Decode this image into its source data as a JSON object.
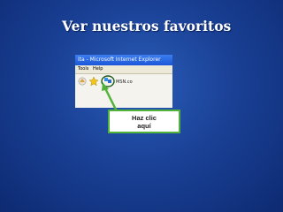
{
  "slide": {
    "title": "Ver nuestros favoritos"
  },
  "browser": {
    "title_text": "ita - Microsoft Internet Explorer",
    "menu": [
      "Tools",
      "Help"
    ],
    "toolbar_label": "MSN.co"
  },
  "callout": {
    "line1": "Haz clic",
    "line2": "aquí"
  },
  "icons": {
    "favorites_button": "favorites-star-icon"
  },
  "colors": {
    "background": "#1a4196",
    "highlight": "#52b33a"
  }
}
